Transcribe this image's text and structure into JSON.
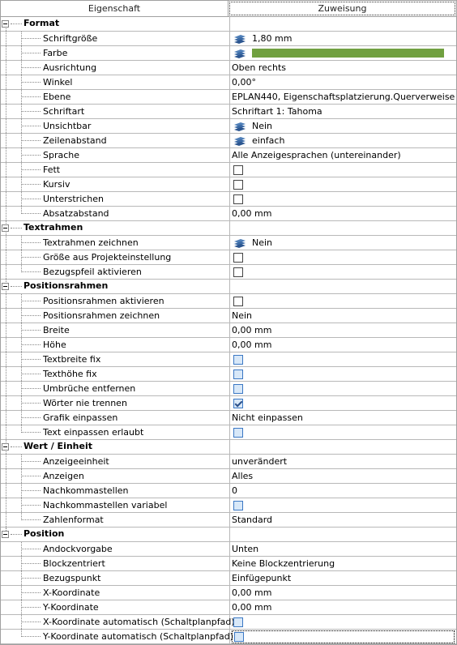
{
  "header": {
    "left": "Eigenschaft",
    "right": "Zuweisung"
  },
  "groups": {
    "format": {
      "label": "Format"
    },
    "textrahmen": {
      "label": "Textrahmen"
    },
    "positionsrahmen": {
      "label": "Positionsrahmen"
    },
    "wert": {
      "label": "Wert / Einheit"
    },
    "position": {
      "label": "Position"
    }
  },
  "rows": {
    "schriftgroesse": {
      "label": "Schriftgröße",
      "value": "1,80 mm"
    },
    "farbe": {
      "label": "Farbe",
      "color": "#70a040"
    },
    "ausrichtung": {
      "label": "Ausrichtung",
      "value": "Oben rechts"
    },
    "winkel": {
      "label": "Winkel",
      "value": "0,00°"
    },
    "ebene": {
      "label": "Ebene",
      "value": "EPLAN440, Eigenschaftsplatzierung.Querverweise"
    },
    "schriftart": {
      "label": "Schriftart",
      "value": "Schriftart 1: Tahoma"
    },
    "unsichtbar": {
      "label": "Unsichtbar",
      "value": "Nein"
    },
    "zeilenabstand": {
      "label": "Zeilenabstand",
      "value": "einfach"
    },
    "sprache": {
      "label": "Sprache",
      "value": "Alle Anzeigesprachen (untereinander)"
    },
    "fett": {
      "label": "Fett"
    },
    "kursiv": {
      "label": "Kursiv"
    },
    "unterstrichen": {
      "label": "Unterstrichen"
    },
    "absatzabstand": {
      "label": "Absatzabstand",
      "value": "0,00 mm"
    },
    "textrahmen_zeichnen": {
      "label": "Textrahmen zeichnen",
      "value": "Nein"
    },
    "groesse_projekt": {
      "label": "Größe aus Projekteinstellung"
    },
    "bezugspfeil": {
      "label": "Bezugspfeil aktivieren"
    },
    "posrahmen_aktivieren": {
      "label": "Positionsrahmen aktivieren"
    },
    "posrahmen_zeichnen": {
      "label": "Positionsrahmen zeichnen",
      "value": "Nein"
    },
    "breite": {
      "label": "Breite",
      "value": "0,00 mm"
    },
    "hoehe": {
      "label": "Höhe",
      "value": "0,00 mm"
    },
    "textbreite_fix": {
      "label": "Textbreite fix"
    },
    "texthoehe_fix": {
      "label": "Texthöhe fix"
    },
    "umbrueche": {
      "label": "Umbrüche entfernen"
    },
    "woerter": {
      "label": "Wörter nie trennen"
    },
    "grafik": {
      "label": "Grafik einpassen",
      "value": "Nicht einpassen"
    },
    "text_einpassen": {
      "label": "Text einpassen erlaubt"
    },
    "anzeigeeinheit": {
      "label": "Anzeigeeinheit",
      "value": "unverändert"
    },
    "anzeigen": {
      "label": "Anzeigen",
      "value": "Alles"
    },
    "nachkomma": {
      "label": "Nachkommastellen",
      "value": "0"
    },
    "nachkomma_var": {
      "label": "Nachkommastellen variabel"
    },
    "zahlenformat": {
      "label": "Zahlenformat",
      "value": "Standard"
    },
    "andock": {
      "label": "Andockvorgabe",
      "value": "Unten"
    },
    "blockzentriert": {
      "label": "Blockzentriert",
      "value": "Keine Blockzentrierung"
    },
    "bezugspunkt": {
      "label": "Bezugspunkt",
      "value": "Einfügepunkt"
    },
    "x_koord": {
      "label": "X-Koordinate",
      "value": "0,00 mm"
    },
    "y_koord": {
      "label": "Y-Koordinate",
      "value": "0,00 mm"
    },
    "x_auto": {
      "label": "X-Koordinate automatisch (Schaltplanpfad)"
    },
    "y_auto": {
      "label": "Y-Koordinate automatisch (Schaltplanpfad)"
    }
  },
  "icons": {
    "layer": "layers-icon",
    "checkbox": "checkbox"
  }
}
